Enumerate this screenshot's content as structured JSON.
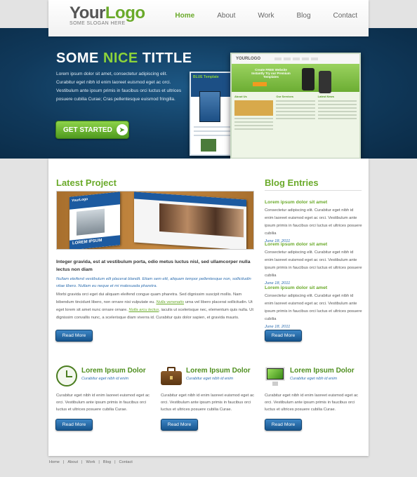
{
  "header": {
    "logo_your": "Your",
    "logo_logo": "Logo",
    "slogan": "SOME SLOGAN HERE",
    "nav": [
      "Home",
      "About",
      "Work",
      "Blog",
      "Contact"
    ],
    "active_nav": "Home"
  },
  "hero": {
    "title_start": "SOME ",
    "title_highlight": "NICE",
    "title_end": " TITTLE",
    "text": "Lorem ipsum dolor sit amet, consectetur adipiscing elit. Curabitur eget nibh id enim laoreet euismod eget ac orci. Vestibulum ante ipsum primis in faucibus orci luctus et ultrices posuere cubilia Curae; Cras pellentesque euismod fringilla.",
    "cta_label": "GET STARTED",
    "slides": 4,
    "active_slide": 2,
    "mock_logo": "YOURLOGO",
    "mock_back_title_1": "BLUE",
    "mock_back_title_2": "Template",
    "mock_banner": "Create FREE Website Instantly Try our Premium Templates",
    "mock_cols": [
      "About Us",
      "Our Services",
      "Latest News"
    ]
  },
  "latest_project": {
    "title": "Latest Project",
    "brochure_logo": "YourLogo",
    "brochure_caption": "LOREM IPSUM",
    "bold_text": "Integer gravida, est at vestibulum porta, odio metus luctus nisl, sed ullamcorper nulla lectus non diam",
    "italic_text": "Nullam eleifend vestibulum elit placerat blandit. Etiam sem elit, aliquam tempor pellentesque non, sollicitudin vitae libero. Nullam eu neque et mi malesuada pharetra.",
    "body_1": "Morbi gravida orci eget dui aliquam eleifend congue quam pharetra. Sed dignissim suscipit mollis. Nam bibendum tincidunt libero, non ornare nisi vulputate eu. ",
    "link_1": "Nulla venenatis",
    "body_2": " urna vel libero placerat sollicitudin. Ut eget lorem sit amet nunc ornare ornare. ",
    "link_2": "Nulla arcu lectus",
    "body_3": ", iaculis ut scelerisque nec, elementum quis nulla. Ut dignissim convallis nunc, a scelerisque diam viverra id. Curabitur quis dolor sapien, et gravida mauris.",
    "button": "Read More"
  },
  "blog": {
    "title": "Blog Entries",
    "entries": [
      {
        "title": "Lorem ipsum dolor sit amet",
        "text": "Consectetur adipiscing elit. Curabitur eget nibh id enim laoreet euismod eget ac orci. Vestibulum ante ipsum primis in faucibus orci luctus et ultrices posuere cubilia",
        "date": "June 18, 2011"
      },
      {
        "title": "Lorem ipsum dolor sit amet",
        "text": "Consectetur adipiscing elit. Curabitur eget nibh id enim laoreet euismod eget ac orci. Vestibulum ante ipsum primis in faucibus orci luctus et ultrices posuere cubilia",
        "date": "June 18, 2011"
      },
      {
        "title": "Lorem ipsum dolor sit amet",
        "text": "Consectetur adipiscing elit. Curabitur eget nibh id enim laoreet euismod eget ac orci. Vestibulum ante ipsum primis in faucibus orci luctus et ultrices posuere cubilia",
        "date": "June 18, 2011"
      }
    ],
    "button": "Read More"
  },
  "features": [
    {
      "icon": "clock-icon",
      "title": "Lorem Ipsum Dolor",
      "subtitle": "Curabitur eget nibh id enim",
      "text": "Curabitur eget nibh id enim laoreet euismod eget ac orci. Vestibulum ante ipsum primis in faucibus orci luctus et ultrices posuere cubilia Curae.",
      "button": "Read More"
    },
    {
      "icon": "briefcase-icon",
      "title": "Lorem Ipsum Dolor",
      "subtitle": "Curabitur eget nibh id enim",
      "text": "Curabitur eget nibh id enim laoreet euismod eget ac orci. Vestibulum ante ipsum primis in faucibus orci luctus et ultrices posuere cubilia Curae.",
      "button": "Read More"
    },
    {
      "icon": "imac-icon",
      "title": "Lorem Ipsum Dolor",
      "subtitle": "Curabitur eget nibh id enim",
      "text": "Curabitur eget nibh id enim laoreet euismod eget ac orci. Vestibulum ante ipsum primis in faucibus orci luctus et ultrices posuere cubilia Curae.",
      "button": "Read More"
    }
  ],
  "footer": {
    "links": [
      "Home",
      "About",
      "Work",
      "Blog",
      "Contact"
    ],
    "separator": "|"
  },
  "colors": {
    "accent_green": "#6aaa2a",
    "hero_blue": "#10395b",
    "button_blue": "#17558d"
  }
}
